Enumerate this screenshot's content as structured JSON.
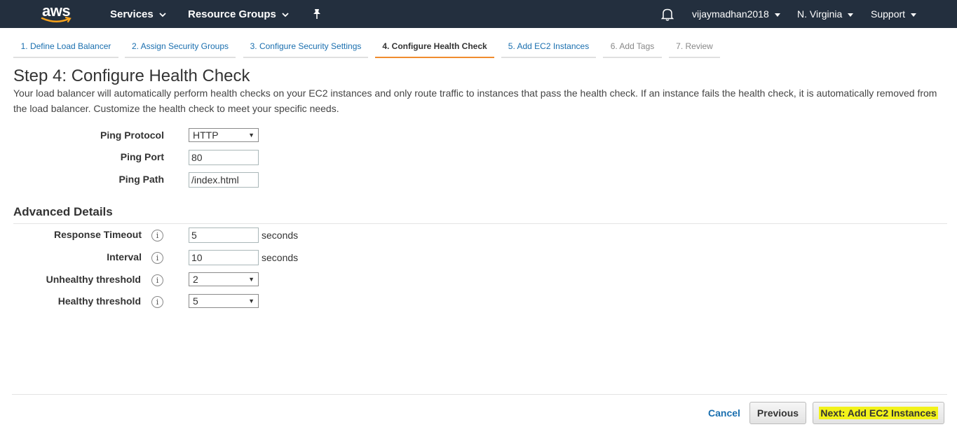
{
  "topnav": {
    "logo_text": "aws",
    "services": "Services",
    "resource_groups": "Resource Groups",
    "user": "vijaymadhan2018",
    "region": "N. Virginia",
    "support": "Support"
  },
  "tabs": [
    {
      "label": "1. Define Load Balancer"
    },
    {
      "label": "2. Assign Security Groups"
    },
    {
      "label": "3. Configure Security Settings"
    },
    {
      "label": "4. Configure Health Check"
    },
    {
      "label": "5. Add EC2 Instances"
    },
    {
      "label": "6. Add Tags"
    },
    {
      "label": "7. Review"
    }
  ],
  "page": {
    "title": "Step 4: Configure Health Check",
    "intro": "Your load balancer will automatically perform health checks on your EC2 instances and only route traffic to instances that pass the health check. If an instance fails the health check, it is automatically removed from the load balancer. Customize the health check to meet your specific needs."
  },
  "ping": {
    "protocol_label": "Ping Protocol",
    "protocol_value": "HTTP",
    "port_label": "Ping Port",
    "port_value": "80",
    "path_label": "Ping Path",
    "path_value": "/index.html"
  },
  "advanced": {
    "title": "Advanced Details",
    "response_timeout_label": "Response Timeout",
    "response_timeout_value": "5",
    "interval_label": "Interval",
    "interval_value": "10",
    "unhealthy_label": "Unhealthy threshold",
    "unhealthy_value": "2",
    "healthy_label": "Healthy threshold",
    "healthy_value": "5",
    "unit": "seconds",
    "info_glyph": "i"
  },
  "footer": {
    "cancel": "Cancel",
    "previous": "Previous",
    "next": "Next: Add EC2 Instances"
  },
  "colors": {
    "topbar": "#232f3e",
    "active_tab_underline": "#f08c2e",
    "link": "#1a6faf",
    "highlight": "#f2f21a"
  }
}
